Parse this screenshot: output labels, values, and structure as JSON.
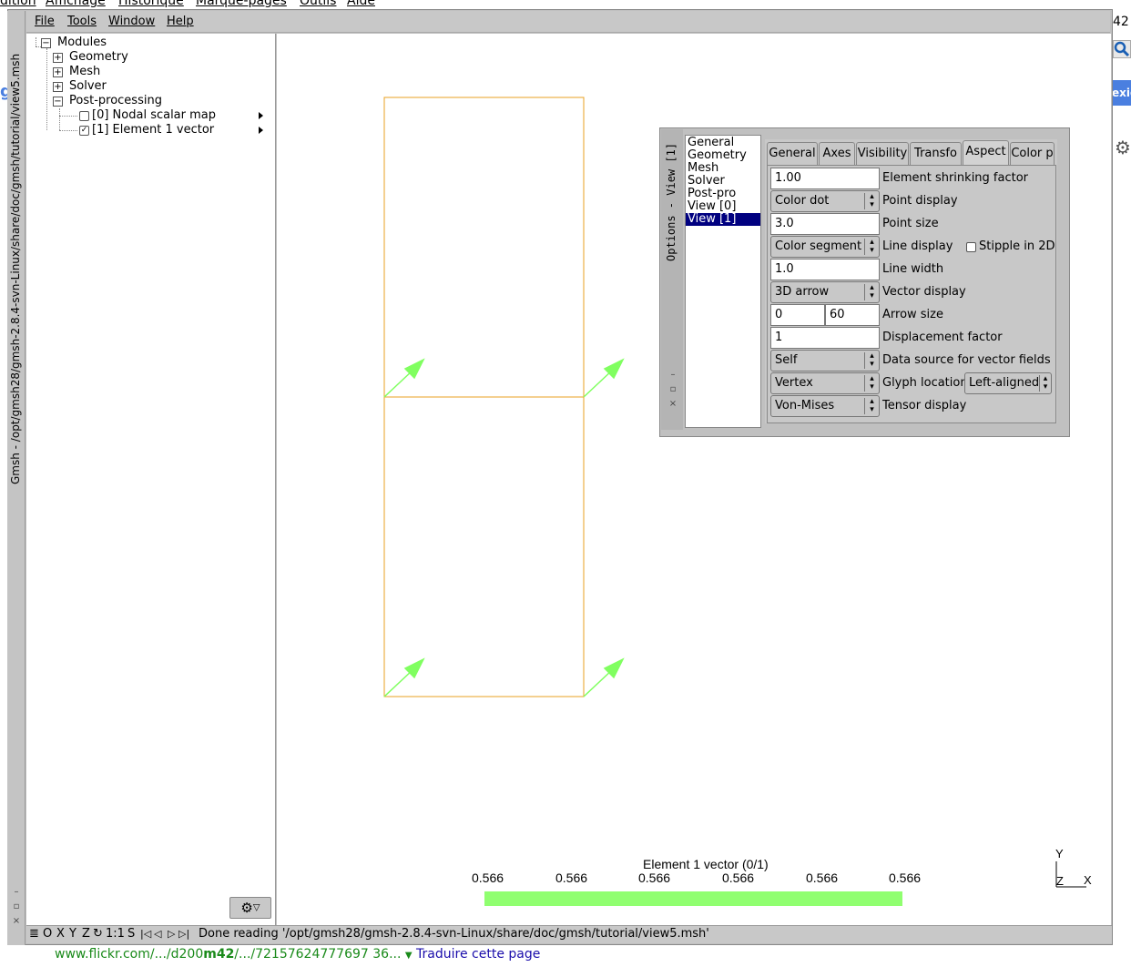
{
  "background_menubar": {
    "items": [
      "dition",
      "Affichage",
      "Historique",
      "Marque-pages",
      "Outils",
      "Aide"
    ]
  },
  "window": {
    "vertical_title": "Gmsh - /opt/gmsh28/gmsh-2.8.4-svn-Linux/share/doc/gmsh/tutorial/view5.msh"
  },
  "menubar": {
    "file": "File",
    "tools": "Tools",
    "window": "Window",
    "help": "Help"
  },
  "tree": {
    "root": "Modules",
    "geometry": "Geometry",
    "mesh": "Mesh",
    "solver": "Solver",
    "postprocessing": "Post-processing",
    "view0": "[0] Nodal scalar map",
    "view1": "[1] Element 1 vector",
    "view0_checked": false,
    "view1_checked": true
  },
  "options": {
    "vertical_title": "Options - View [1]",
    "categories": [
      "General",
      "Geometry",
      "Mesh",
      "Solver",
      "Post-pro",
      "View [0]",
      "View [1]"
    ],
    "selected_category": "View [1]",
    "tabs": [
      "General",
      "Axes",
      "Visibility",
      "Transfo",
      "Aspect",
      "Color p"
    ],
    "active_tab": "Aspect",
    "fields": {
      "shrink_value": "1.00",
      "shrink_label": "Element shrinking factor",
      "point_display_value": "Color dot",
      "point_display_label": "Point display",
      "point_size_value": "3.0",
      "point_size_label": "Point size",
      "line_display_value": "Color segment",
      "line_display_label": "Line display",
      "stipple_label": "Stipple in 2D",
      "stipple_checked": false,
      "line_width_value": "1.0",
      "line_width_label": "Line width",
      "vector_display_value": "3D arrow",
      "vector_display_label": "Vector display",
      "arrow_size_min": "0",
      "arrow_size_max": "60",
      "arrow_size_label": "Arrow size",
      "displacement_value": "1",
      "displacement_label": "Displacement factor",
      "data_source_value": "Self",
      "data_source_label": "Data source for vector fields",
      "glyph_value": "Vertex",
      "glyph_label": "Glyph location",
      "glyph_align_value": "Left-aligned",
      "tensor_value": "Von-Mises",
      "tensor_label": "Tensor display"
    }
  },
  "scale": {
    "title": "Element 1 vector (0/1)",
    "values": [
      "0.566",
      "0.566",
      "0.566",
      "0.566",
      "0.566",
      "0.566"
    ],
    "bar_color": "#90ff70"
  },
  "axes": {
    "y": "Y",
    "z": "Z",
    "x": "X"
  },
  "statusbar": {
    "o": "O",
    "x": "X",
    "y": "Y",
    "z": "Z",
    "scale": "1:1",
    "s": "S",
    "message": "Done reading '/opt/gmsh28/gmsh-2.8.4-svn-Linux/share/doc/gmsh/tutorial/view5.msh'"
  },
  "bottom_link": {
    "url_prefix": "www.flickr.com/.../d200",
    "url_bold": "m42",
    "url_suffix": "/.../72157624777697 36...",
    "translate": "Traduire cette page"
  },
  "right_strip": {
    "num": "42",
    "badge": "exio"
  },
  "colors": {
    "mesh_lines": "#e8a020",
    "arrows": "#80ff60",
    "selection": "#000080"
  }
}
